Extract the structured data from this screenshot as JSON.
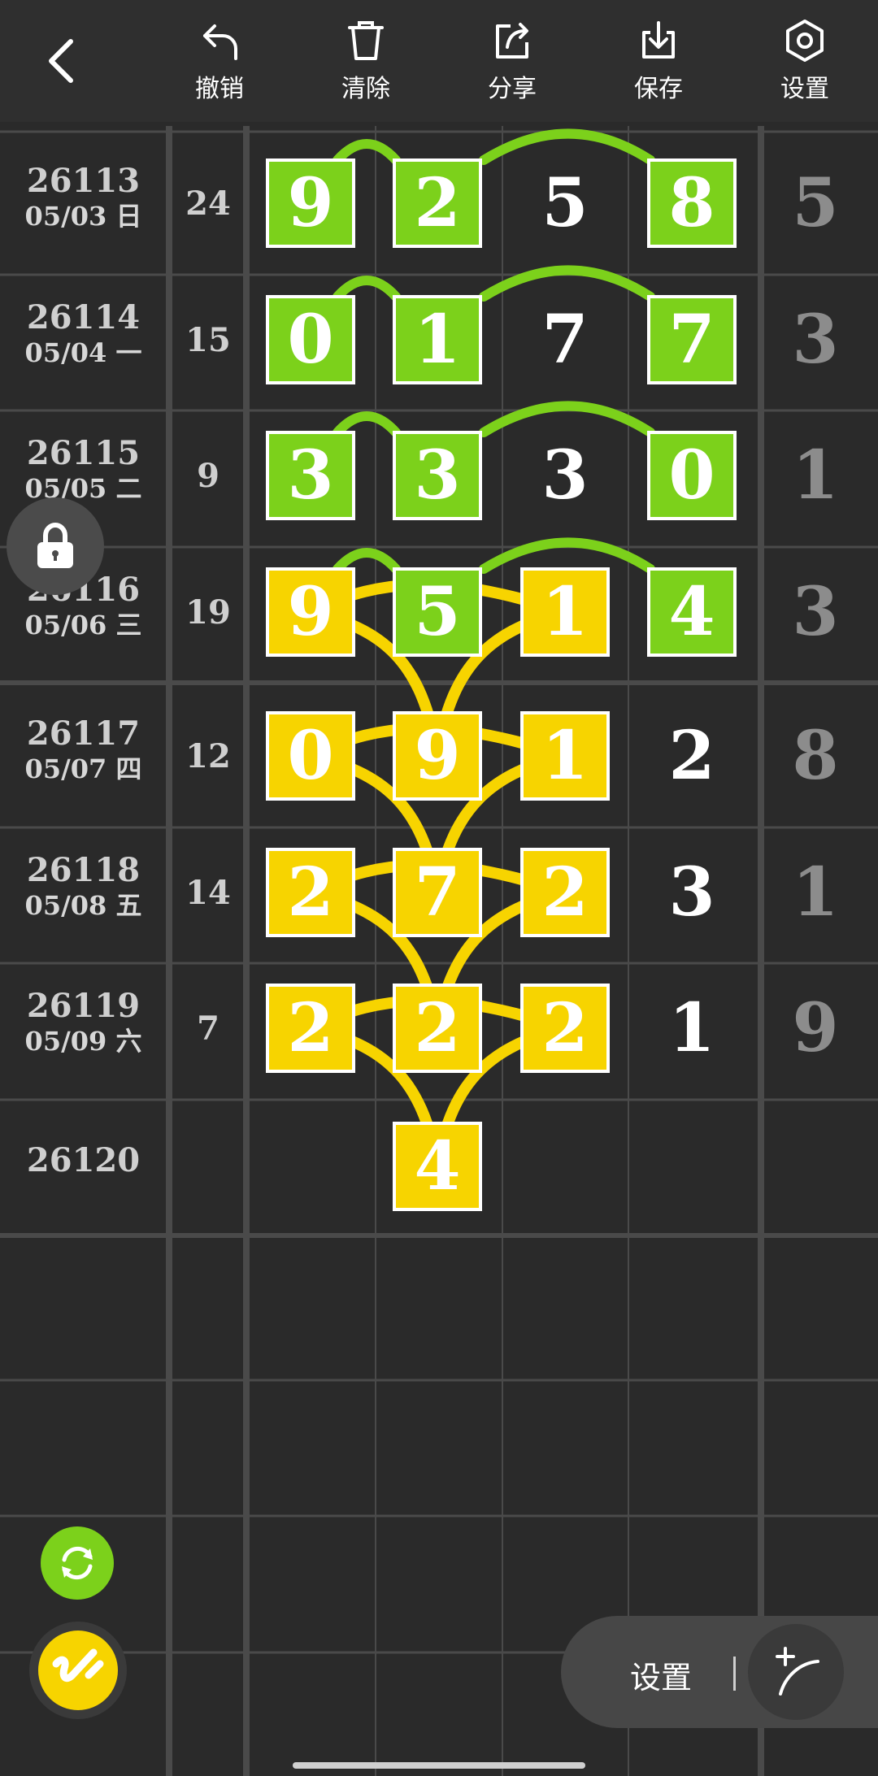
{
  "toolbar": {
    "undo_label": "撤销",
    "clear_label": "清除",
    "share_label": "分享",
    "save_label": "保存",
    "settings_label": "设置"
  },
  "rows": [
    {
      "issue": "26113",
      "date": "05/03 日",
      "sum": "24",
      "digits": [
        "9",
        "2",
        "5",
        "8"
      ],
      "last": "5"
    },
    {
      "issue": "26114",
      "date": "05/04 一",
      "sum": "15",
      "digits": [
        "0",
        "1",
        "7",
        "7"
      ],
      "last": "3"
    },
    {
      "issue": "26115",
      "date": "05/05 二",
      "sum": "9",
      "digits": [
        "3",
        "3",
        "3",
        "0"
      ],
      "last": "1"
    },
    {
      "issue": "26116",
      "date": "05/06 三",
      "sum": "19",
      "digits": [
        "9",
        "5",
        "1",
        "4"
      ],
      "last": "3"
    },
    {
      "issue": "26117",
      "date": "05/07 四",
      "sum": "12",
      "digits": [
        "0",
        "9",
        "1",
        "2"
      ],
      "last": "8"
    },
    {
      "issue": "26118",
      "date": "05/08 五",
      "sum": "14",
      "digits": [
        "2",
        "7",
        "2",
        "3"
      ],
      "last": "1"
    },
    {
      "issue": "26119",
      "date": "05/09 六",
      "sum": "7",
      "digits": [
        "2",
        "2",
        "2",
        "1"
      ],
      "last": "9"
    },
    {
      "issue": "26120",
      "date": "",
      "sum": "",
      "digits": [
        "",
        "4",
        "",
        ""
      ],
      "last": ""
    }
  ],
  "bottom": {
    "settings_label": "设置"
  },
  "colors": {
    "green": "#7cd11b",
    "yellow": "#f7d400",
    "background": "#2a2a2a"
  }
}
